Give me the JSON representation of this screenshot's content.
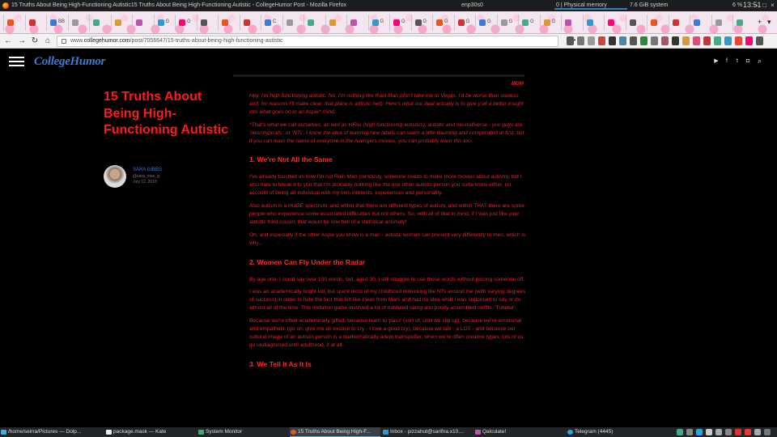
{
  "window": {
    "title": "15 Truths About Being High-Functioning Autistic15 Truths About Being High-Functioning Autistic - CollegeHumor Post - Mozilla Firefox"
  },
  "sysbar": {
    "net": "enp30s0",
    "cpu": "0",
    "mem": "0 | Physical memory",
    "swap": "7.6 GiB system",
    "battery": "6 %",
    "clock": "13:51"
  },
  "tabs": {
    "items": [
      "",
      "",
      "BB",
      "",
      "",
      "",
      "",
      "G",
      "G",
      "",
      "",
      "",
      "C",
      "",
      "",
      "",
      "",
      "G",
      "G",
      "G",
      "G",
      "G",
      "G",
      "G",
      "G",
      "G",
      "",
      "",
      "",
      "",
      "",
      "",
      "",
      "",
      ""
    ],
    "active_label": "con"
  },
  "navbar": {
    "url_prefix": "www.",
    "url_domain": "collegehumor.com",
    "url_path": "/post/7056647/15-truths-about-being-high-functioning-autistic",
    "more": "•••"
  },
  "site": {
    "logo": "CollegeHumor",
    "social_icons": [
      "youtube-icon",
      "facebook-icon",
      "twitter-icon",
      "instagram-icon"
    ]
  },
  "article": {
    "tag": "MOM",
    "title": "15 Truths About Being High-Functioning Autistic",
    "author": {
      "name": "SARA GIBBS",
      "handle": "@sara_rose_g",
      "date": "July 12, 2018"
    },
    "intro": [
      "Hey, I'm high-functioning autistic. No, I'm nothing like Rain Man (don't take me to Vegas, I'd be worse than useless and, for reasons I'll make clear, that place is autistic hell). Here's what our deal actually is to give y'all a better insight into what goes on in an Aspie* mind.",
      "*That's what we call ourselves, as well as HFAs (high-functioning autistics), autistic and neurodiverse - you guys are 'neurotypicals', or 'NTs'. I know the idea of learning new labels can seem a little daunting and complicated at first, but if you can learn the name of everyone in the Avengers movies, you can probably learn this too."
    ],
    "sections": [
      {
        "heading": "1. We're Not All the Same",
        "paragraphs": [
          "I've already touched on how I'm not Rain Man (seriously, someone needs to make more movies about autism), but I also hate to break it to you that I'm probably nothing like the one other autistic person you sorta know either, on account of being an individual with my own interests, experiences and personality.",
          "Also autism is a HUGE spectrum, and within that there are different types of autism, and within THAT there are some people who experience some associated difficulties but not others. So, with all of that in mind, if I was just like your autistic third cousin, that would be one hell of a statistical anomaly!",
          "Oh, and especially if the other Aspie you know is a man - autistic women can present very differently to men, which is why..."
        ]
      },
      {
        "heading": "2. Women Can Fly Under the Radar",
        "paragraphs": [
          "By age one, I could say over 100 words, but, aged 30, I still struggle to use those words without pissing someone off.",
          "I was an academically bright kid, but spent most of my childhood mimicking the NTs around me (with varying degrees of success) in order to hide the fact that felt like I was from Mars and had no idea what I was supposed to say or do almost all of the time. This imitation game involved a lot of outdated slang and poorly assembled outfits. 'Tubular'.",
          "Because we're often academically gifted, because learn to 'pass' (sort of, until we slip up), because we're emotional and empathetic (go on, give me an excuse to cry - I love a good cry), because we talk - a LOT - and because our cultural image of an autistic person is a mathematically adept trainspotter, when we're often creative types, lots of us go undiagnosed until adulthood, if at all."
        ]
      },
      {
        "heading": "3. We Tell It As It Is",
        "paragraphs": []
      }
    ]
  },
  "taskbar": {
    "tasks": [
      "/home/seirra/Pictures — Dolp...",
      "package.mask — Kate",
      "System Monitor",
      "15 Truths About Being High-F...",
      "Inbox - pizzahut@sarifna.x10....",
      "Qalculate!",
      "Telegram (4445)"
    ]
  },
  "colors": {
    "accent_red": "#ff1a1a",
    "logo_blue": "#3a7bd5",
    "background": "#000000"
  }
}
